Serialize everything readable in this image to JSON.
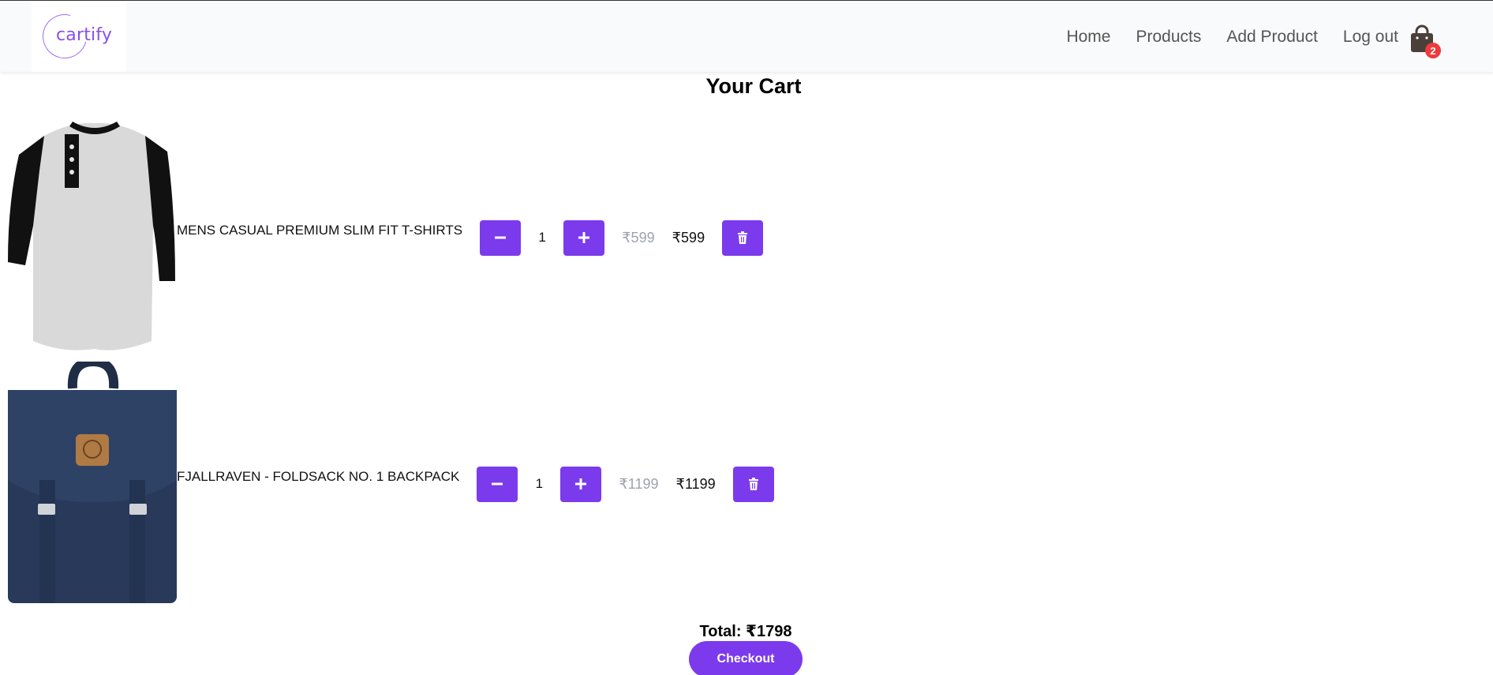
{
  "header": {
    "logo_text": "cartify",
    "nav": [
      "Home",
      "Products",
      "Add Product",
      "Log out"
    ],
    "cart_count": "2"
  },
  "page_title": "Your Cart",
  "cart_items": [
    {
      "name": "MENS CASUAL PREMIUM SLIM FIT T-SHIRTS",
      "quantity": "1",
      "original_price": "₹599",
      "price": "₹599"
    },
    {
      "name": "FJALLRAVEN - FOLDSACK NO. 1 BACKPACK",
      "quantity": "1",
      "original_price": "₹1199",
      "price": "₹1199"
    }
  ],
  "summary": {
    "total": "Total: ₹1798",
    "checkout_label": "Checkout"
  },
  "colors": {
    "accent": "#7c3aed",
    "badge": "#ef3b3b",
    "logo": "#8a4fe8"
  }
}
